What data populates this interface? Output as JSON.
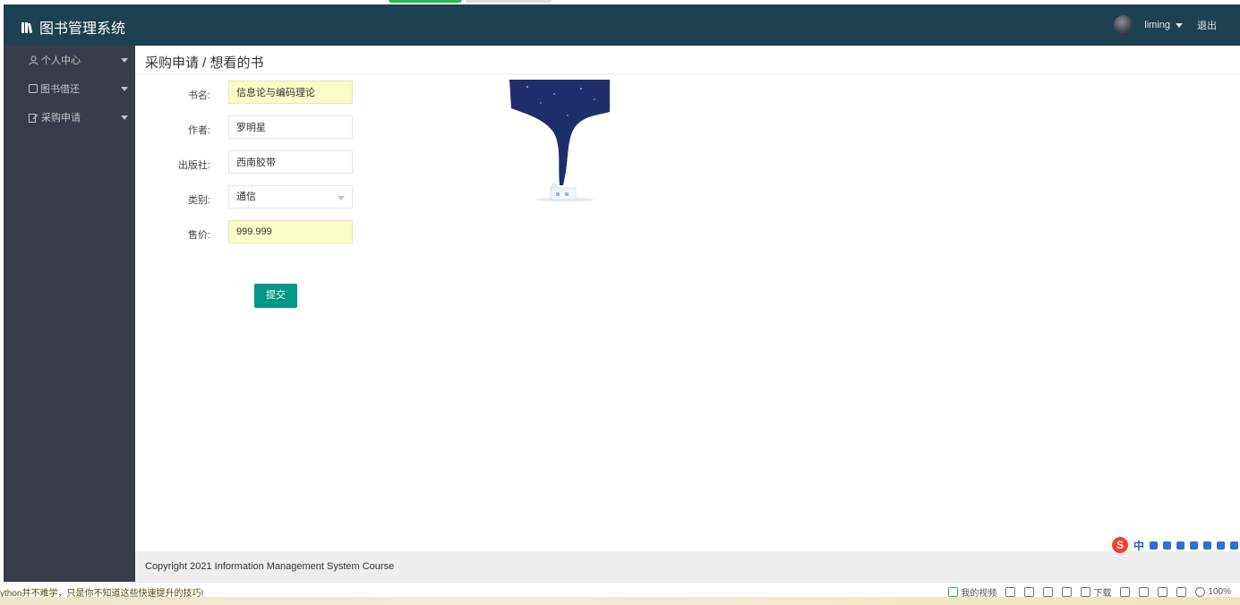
{
  "header": {
    "app_title": "图书管理系统",
    "username": "liming",
    "logout": "退出"
  },
  "sidebar": {
    "items": [
      {
        "label": "个人中心"
      },
      {
        "label": "图书借还"
      },
      {
        "label": "采购申请"
      }
    ]
  },
  "main": {
    "breadcrumb": "采购申请 / 想看的书",
    "form": {
      "book_name_label": "书名:",
      "book_name_value": "信息论与编码理论",
      "author_label": "作者:",
      "author_value": "罗明星",
      "publisher_label": "出版社:",
      "publisher_value": "西南胶带",
      "category_label": "类别:",
      "category_value": "通信",
      "price_label": "售价:",
      "price_value": "999.999",
      "submit_label": "提交"
    }
  },
  "footer": {
    "copyright": "Copyright 2021 Information Management System Course"
  },
  "ime": {
    "logo": "S",
    "mode": "中"
  },
  "statusbar": {
    "left_text": "ython并不难学，只是你不知道这些快速提升的技巧!",
    "video": "我的视频",
    "download": "下载",
    "zoom": "100%"
  }
}
